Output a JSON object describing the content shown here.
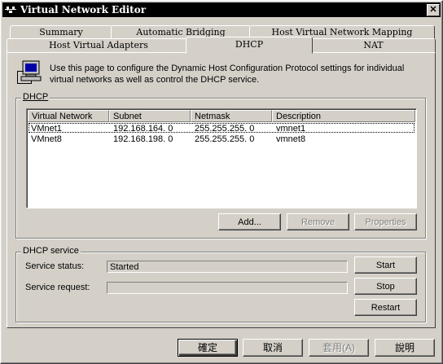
{
  "window": {
    "title": "Virtual Network Editor",
    "close_glyph": "✕"
  },
  "tabs_row1": [
    {
      "label": "Summary"
    },
    {
      "label": "Automatic Bridging"
    },
    {
      "label": "Host Virtual Network Mapping"
    }
  ],
  "tabs_row2": [
    {
      "label": "Host Virtual Adapters"
    },
    {
      "label": "DHCP"
    },
    {
      "label": "NAT"
    }
  ],
  "intro": {
    "icon": "computer-network-icon",
    "text": "Use this page to configure the Dynamic Host Configuration Protocol settings for individual virtual networks as well as control the DHCP service."
  },
  "dhcp_group": {
    "label": "DHCP",
    "columns": [
      "Virtual Network",
      "Subnet",
      "Netmask",
      "Description"
    ],
    "rows": [
      {
        "network": "VMnet1",
        "subnet": "192.168.164.  0",
        "netmask": "255.255.255.  0",
        "description": "vmnet1"
      },
      {
        "network": "VMnet8",
        "subnet": "192.168.198.  0",
        "netmask": "255.255.255.  0",
        "description": "vmnet8"
      }
    ],
    "buttons": {
      "add": "Add...",
      "remove": "Remove",
      "properties": "Properties"
    }
  },
  "service_group": {
    "label": "DHCP service",
    "status_label": "Service status:",
    "status_value": "Started",
    "request_label": "Service request:",
    "request_value": "",
    "buttons": {
      "start": "Start",
      "stop": "Stop",
      "restart": "Restart"
    }
  },
  "dialog_buttons": {
    "ok": "確定",
    "cancel": "取消",
    "apply": "套用(A)",
    "help": "說明"
  }
}
